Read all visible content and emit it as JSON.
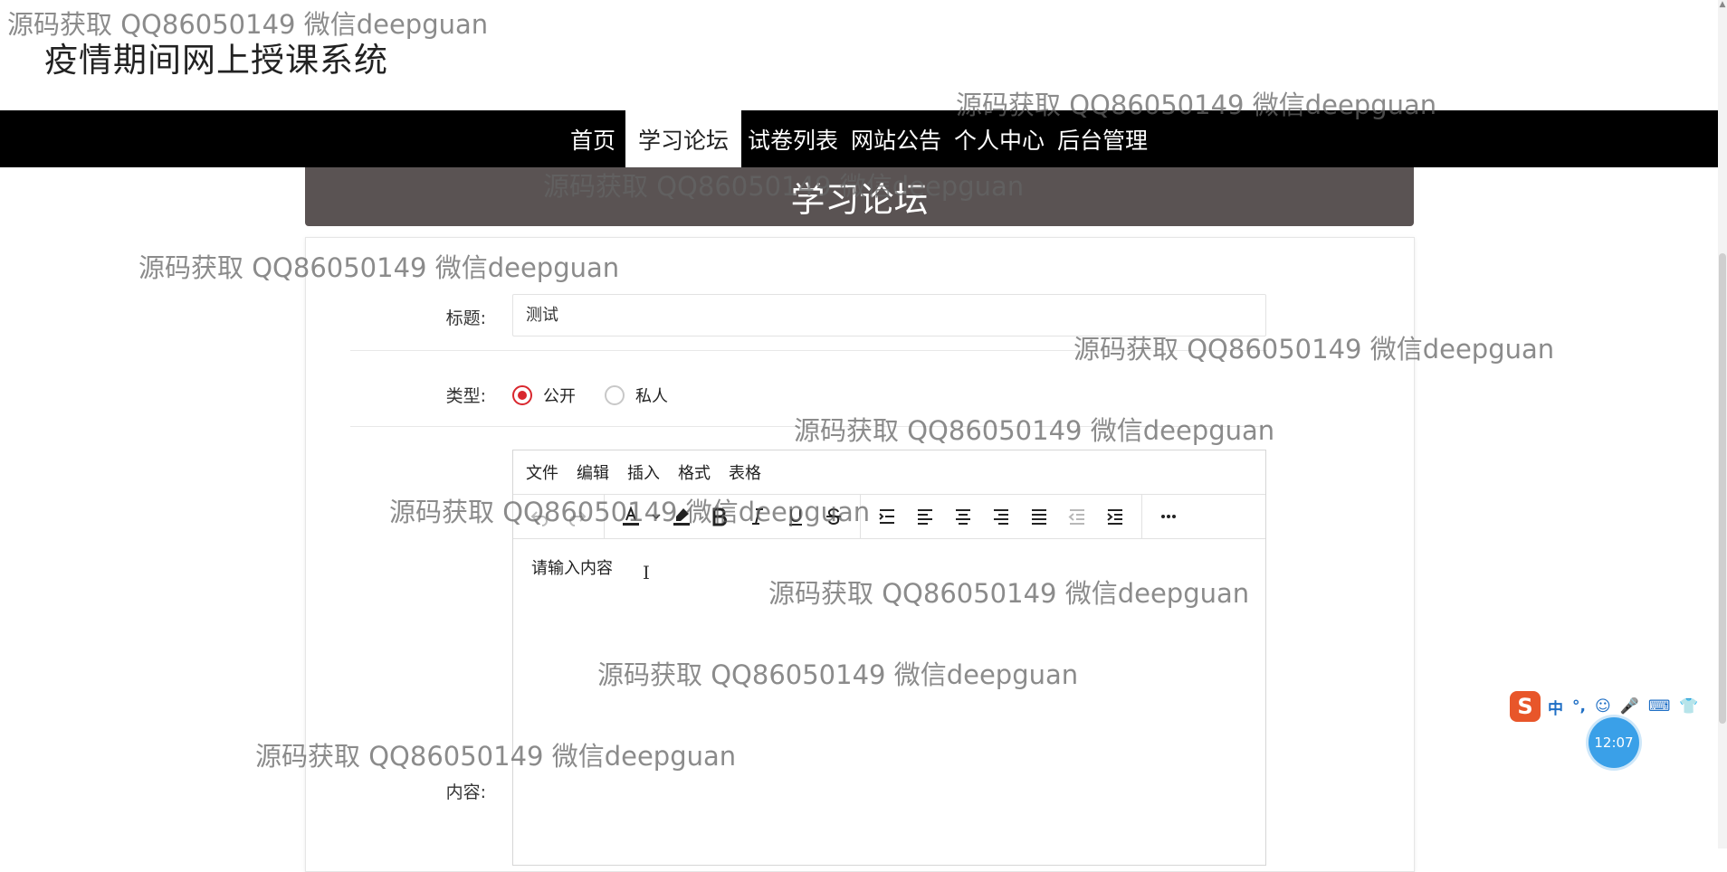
{
  "site": {
    "title": "疫情期间网上授课系统"
  },
  "nav": {
    "items": [
      {
        "label": "首页"
      },
      {
        "label": "学习论坛"
      },
      {
        "label": "试卷列表"
      },
      {
        "label": "网站公告"
      },
      {
        "label": "个人中心"
      },
      {
        "label": "后台管理"
      }
    ],
    "active": "学习论坛"
  },
  "banner": {
    "title": "学习论坛"
  },
  "form": {
    "title_label": "标题:",
    "title_value": "测试",
    "type_label": "类型:",
    "type_options": [
      {
        "label": "公开",
        "checked": true
      },
      {
        "label": "私人",
        "checked": false
      }
    ],
    "content_label": "内容:"
  },
  "editor": {
    "menu": [
      "文件",
      "编辑",
      "插入",
      "格式",
      "表格"
    ],
    "toolbar_icons": [
      "undo-icon",
      "redo-icon",
      "font-color-icon",
      "highlight-icon",
      "bold-icon",
      "italic-icon",
      "underline-icon",
      "strikethrough-icon",
      "line-height-icon",
      "align-left-icon",
      "align-center-icon",
      "align-right-icon",
      "justify-icon",
      "outdent-icon",
      "indent-icon",
      "more-icon"
    ],
    "placeholder": "请输入内容"
  },
  "watermark": {
    "text": "源码获取 QQ86050149 微信deepguan"
  },
  "ime": {
    "items": [
      "中",
      "°,",
      "☺",
      "🎤",
      "⌨",
      "👕"
    ]
  },
  "clock": {
    "time": "12:07"
  },
  "colors": {
    "nav_bg": "#000000",
    "banner_bg": "#5a5353",
    "radio_checked": "#d9272e",
    "clock_bg": "#3aa0e8"
  }
}
